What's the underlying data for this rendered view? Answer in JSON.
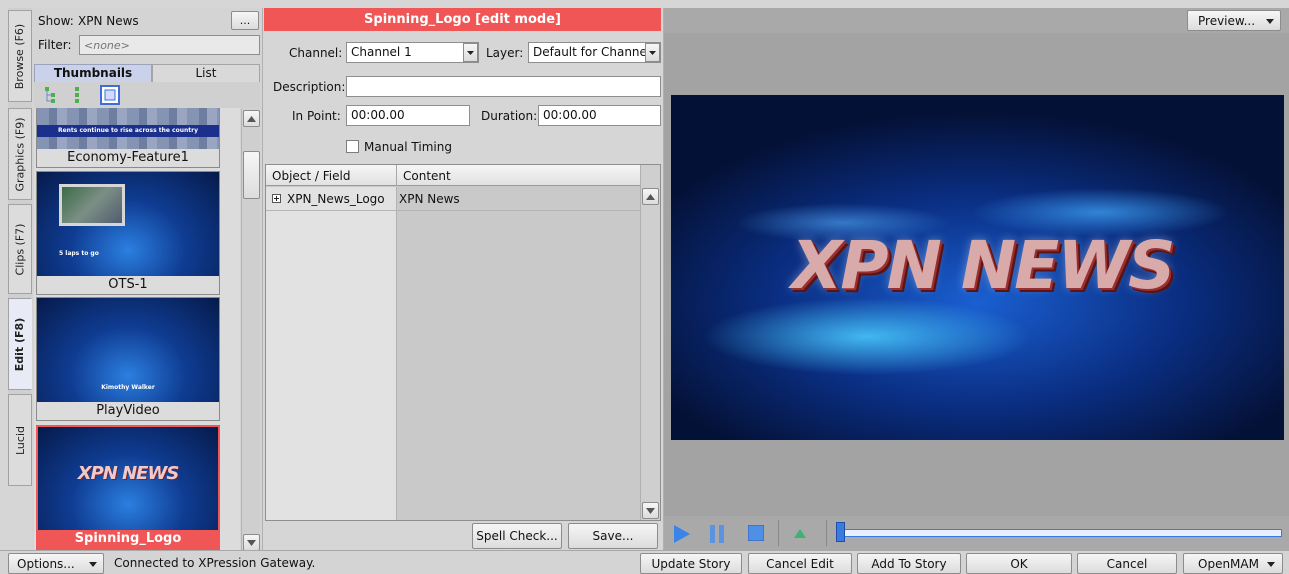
{
  "tabs": [
    "Browse (F6)",
    "Graphics (F9)",
    "Clips (F7)",
    "Edit (F8)",
    "Lucid"
  ],
  "browser": {
    "show_label": "Show:",
    "show_value": "XPN News",
    "more_label": "...",
    "filter_label": "Filter:",
    "filter_placeholder": "<none>",
    "view_tabs": [
      "Thumbnails",
      "List"
    ],
    "items": [
      {
        "caption": "Economy-Feature1",
        "overlay": "Rents continue to rise across the country"
      },
      {
        "caption": "OTS-1",
        "overlay": "5 laps to go"
      },
      {
        "caption": "PlayVideo",
        "overlay": "Kimothy Walker"
      },
      {
        "caption": "Spinning_Logo",
        "overlay": "XPN NEWS"
      }
    ]
  },
  "edit": {
    "title": "Spinning_Logo [edit mode]",
    "channel_label": "Channel:",
    "channel_value": "Channel 1",
    "layer_label": "Layer:",
    "layer_value": "Default for Channe",
    "description_label": "Description:",
    "description_value": "",
    "inpoint_label": "In Point:",
    "inpoint_value": "00:00.00",
    "duration_label": "Duration:",
    "duration_value": "00:00.00",
    "manual_timing_label": "Manual Timing",
    "grid_headers": [
      "Object / Field",
      "Content"
    ],
    "grid_rows": [
      {
        "object": "XPN_News_Logo",
        "content": "XPN News"
      }
    ],
    "spell_check_label": "Spell Check...",
    "save_label": "Save..."
  },
  "preview": {
    "preview_button_label": "Preview...",
    "logo_text": "XPN NEWS"
  },
  "status": {
    "options_label": "Options...",
    "message": "Connected to XPression Gateway.",
    "buttons": [
      "Update Story",
      "Cancel Edit",
      "Add To Story",
      "OK",
      "Cancel",
      "OpenMAM"
    ]
  }
}
